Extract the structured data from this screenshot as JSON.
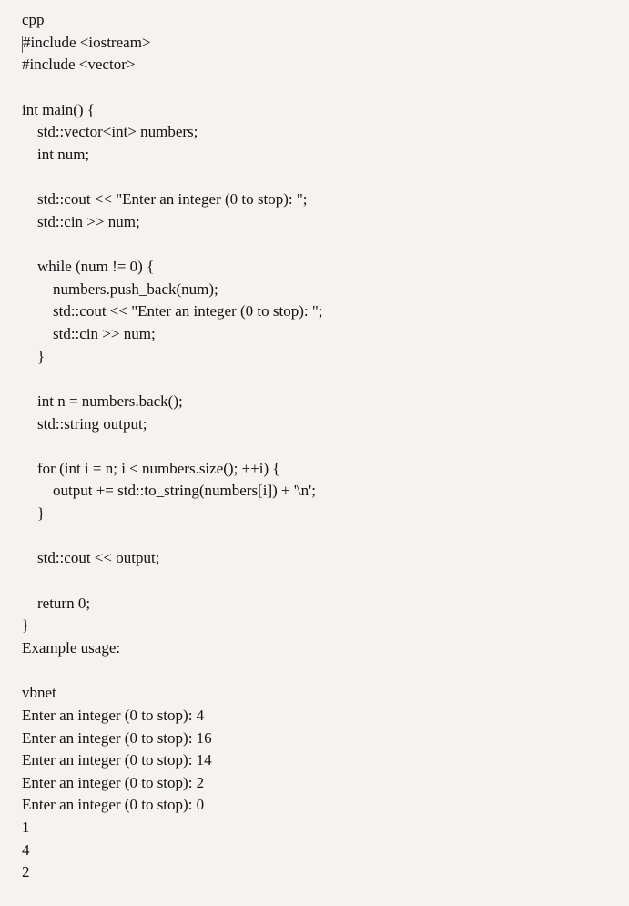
{
  "code_block": {
    "language_tag": "cpp",
    "lines": [
      "#include <iostream>",
      "#include <vector>",
      "",
      "int main() {",
      "    std::vector<int> numbers;",
      "    int num;",
      "",
      "    std::cout << \"Enter an integer (0 to stop): \";",
      "    std::cin >> num;",
      "",
      "    while (num != 0) {",
      "        numbers.push_back(num);",
      "        std::cout << \"Enter an integer (0 to stop): \";",
      "        std::cin >> num;",
      "    }",
      "",
      "    int n = numbers.back();",
      "    std::string output;",
      "",
      "    for (int i = n; i < numbers.size(); ++i) {",
      "        output += std::to_string(numbers[i]) + '\\n';",
      "    }",
      "",
      "    std::cout << output;",
      "",
      "    return 0;",
      "}"
    ]
  },
  "example_label": "Example usage:",
  "output_block": {
    "language_tag": "vbnet",
    "lines": [
      "Enter an integer (0 to stop): 4",
      "Enter an integer (0 to stop): 16",
      "Enter an integer (0 to stop): 14",
      "Enter an integer (0 to stop): 2",
      "Enter an integer (0 to stop): 0",
      "1",
      "4",
      "2"
    ]
  }
}
